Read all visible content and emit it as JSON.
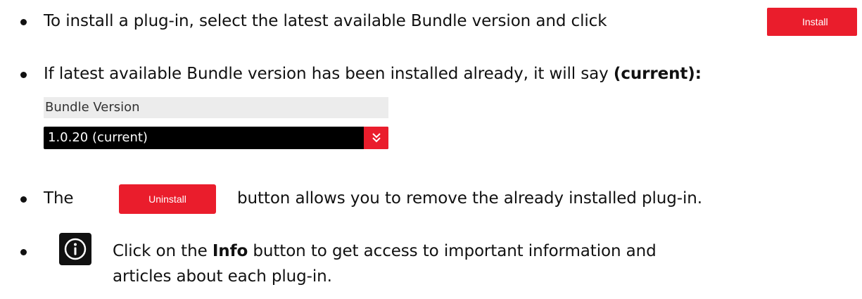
{
  "line1": {
    "text": "To install a plug-in, select the latest available Bundle version and click",
    "button_label": "Install"
  },
  "line2": {
    "text": "If latest available Bundle version has been installed already, it will say ",
    "bold": "(current):"
  },
  "bundle": {
    "header": "Bundle Version",
    "selected": "1.0.20  (current)"
  },
  "line3": {
    "before": "The",
    "button_label": "Uninstall",
    "after": "button allows you to remove the already installed plug-in."
  },
  "line4": {
    "before": "Click on the ",
    "bold": "Info",
    "after": " button to get access to important information and",
    "continuation": "articles about each plug-in."
  },
  "colors": {
    "accent": "#ea1d2c",
    "text": "#111111",
    "select_bg": "#000000"
  },
  "icons": {
    "info": "info-icon",
    "dropdown": "chevron-double-down-icon"
  }
}
